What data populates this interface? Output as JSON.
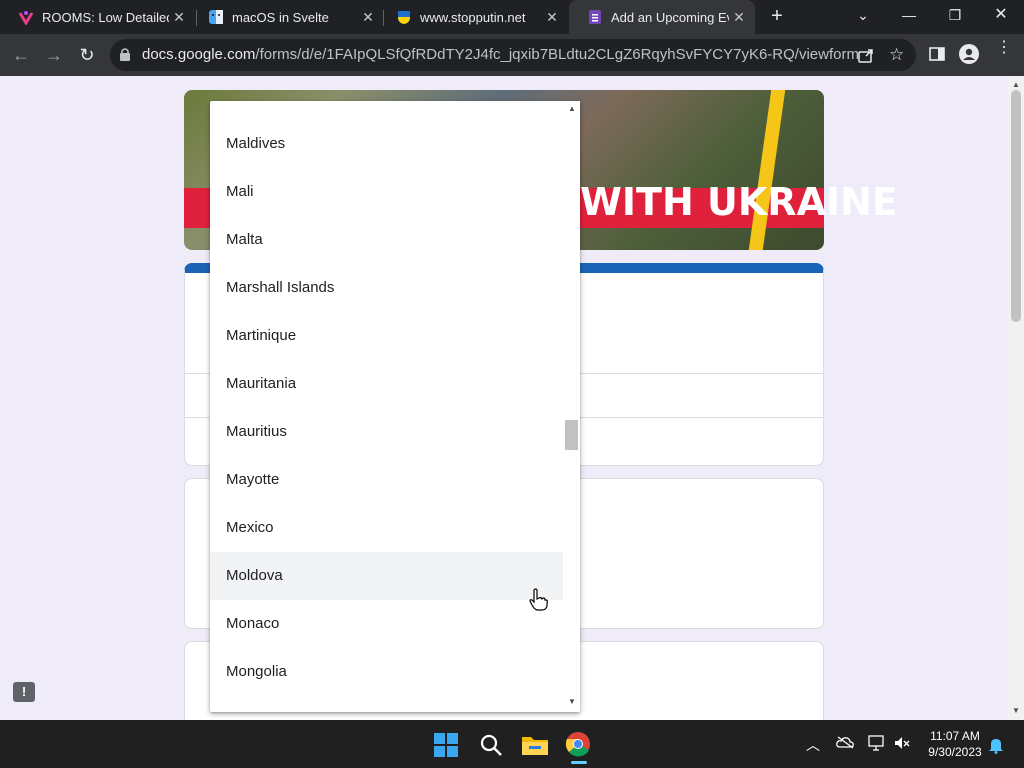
{
  "browser": {
    "tabs": [
      {
        "title": "ROOMS: Low Detailed",
        "active": false
      },
      {
        "title": "macOS in Svelte",
        "active": false
      },
      {
        "title": "www.stopputin.net",
        "active": false
      },
      {
        "title": "Add an Upcoming Eve",
        "active": true
      }
    ],
    "new_tab_icon": "+",
    "url_host": "docs.google.com",
    "url_path": "/forms/d/e/1FAIpQLSfQfRDdTY2J4fc_jqxib7BLdtu2CLgZ6RqyhSvFYCY7yK6-RQ/viewform"
  },
  "banner": {
    "text": "WITH UKRAINE"
  },
  "dropdown": {
    "options": [
      "Maldives",
      "Mali",
      "Malta",
      "Marshall Islands",
      "Martinique",
      "Mauritania",
      "Mauritius",
      "Mayotte",
      "Mexico",
      "Moldova",
      "Monaco",
      "Mongolia"
    ],
    "hovered": "Moldova"
  },
  "taskbar": {
    "time": "11:07 AM",
    "date": "9/30/2023"
  },
  "colors": {
    "accent": "#1a63b5",
    "banner_red": "#e0213c",
    "ukraine_yellow": "#f5c518"
  }
}
